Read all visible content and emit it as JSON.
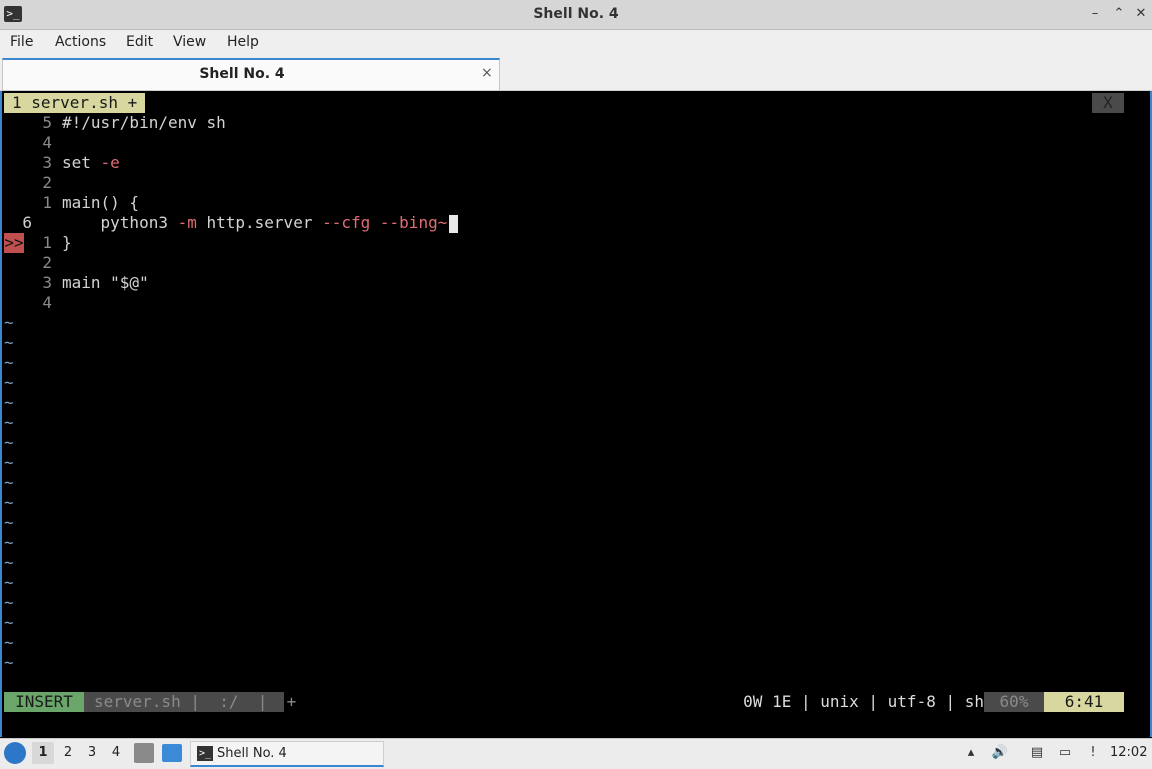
{
  "window": {
    "title": "Shell No. 4",
    "controls": [
      "–",
      "⌃",
      "✕"
    ],
    "app_icon": ">_"
  },
  "menu": [
    "File",
    "Actions",
    "Edit",
    "View",
    "Help"
  ],
  "tab": {
    "label": "Shell No. 4",
    "close": "×"
  },
  "vim": {
    "buffer_tab": "1 server.sh +",
    "close_buffer": "X",
    "lines": [
      {
        "num": "5",
        "text": "#!/usr/bin/env sh"
      },
      {
        "num": "4",
        "text": ""
      },
      {
        "num": "3",
        "code": "set ",
        "flag": "-e"
      },
      {
        "num": "2",
        "text": ""
      },
      {
        "num": "1",
        "text": "main() {"
      },
      {
        "num": "6",
        "current": true,
        "parts": [
          "    python3 ",
          "-m",
          " http.server ",
          "--cfg",
          " ",
          "--bing~"
        ]
      },
      {
        "num": "1",
        "text": "}",
        "sign": ">>"
      },
      {
        "num": "2",
        "text": ""
      },
      {
        "num": "3",
        "text": "main \"$@\""
      },
      {
        "num": "4",
        "text": ""
      }
    ],
    "tilde": "~",
    "status": {
      "mode": "INSERT",
      "file": "server.sh |  :/  |  +",
      "right": "0W 1E | unix | utf-8 | sh",
      "percent": "60%",
      "position": "6:41"
    }
  },
  "taskbar": {
    "workspaces": [
      "1",
      "2",
      "3",
      "4"
    ],
    "task_label": "Shell No. 4",
    "clock": "12:02"
  }
}
